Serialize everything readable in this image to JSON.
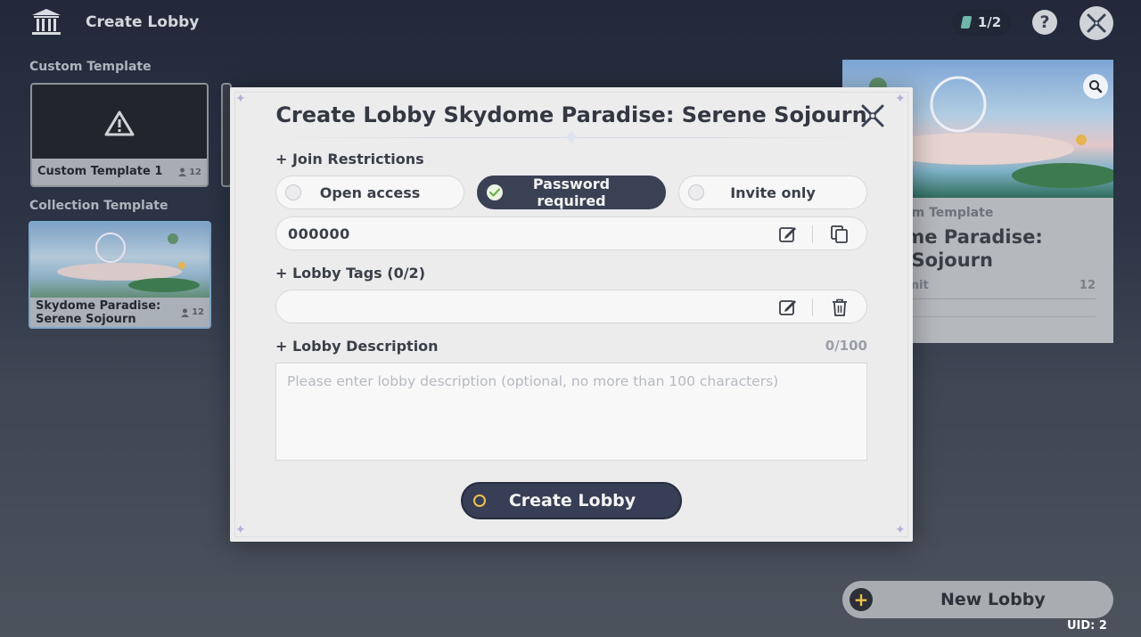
{
  "topbar": {
    "title": "Create Lobby",
    "counter": "1/2",
    "help_label": "?"
  },
  "sidebar": {
    "custom_section": "Custom Template",
    "custom_card": {
      "name": "Custom Template 1",
      "players": "12"
    },
    "collection_section": "Collection Template",
    "collection_card": {
      "name_line1": "Skydome Paradise:",
      "name_line2": "Serene Sojourn",
      "players": "12"
    }
  },
  "preview": {
    "subtitle": "om Template",
    "title_line1": "ome Paradise:",
    "title_line2": "e Sojourn",
    "limit_label": "imit",
    "limit_value": "12"
  },
  "new_lobby": {
    "label": "New Lobby",
    "plus": "+"
  },
  "uid": "UID: 2",
  "modal": {
    "title": "Create Lobby Skydome Paradise: Serene Sojourn",
    "join_label": "+ Join Restrictions",
    "options": [
      {
        "label": "Open access",
        "selected": false
      },
      {
        "label": "Password required",
        "selected": true
      },
      {
        "label": "Invite only",
        "selected": false
      }
    ],
    "password_value": "000000",
    "tags_label": "+ Lobby Tags (0/2)",
    "description_label": "+ Lobby Description",
    "description_count": "0/100",
    "description_placeholder": "Please enter lobby description (optional, no more than 100 characters)",
    "create_button": "Create Lobby"
  },
  "colors": {
    "modal_bg": "#ececed",
    "active_pill": "#3b4154",
    "accent_yellow": "#f0c24a",
    "check_green": "#6ab04c"
  }
}
